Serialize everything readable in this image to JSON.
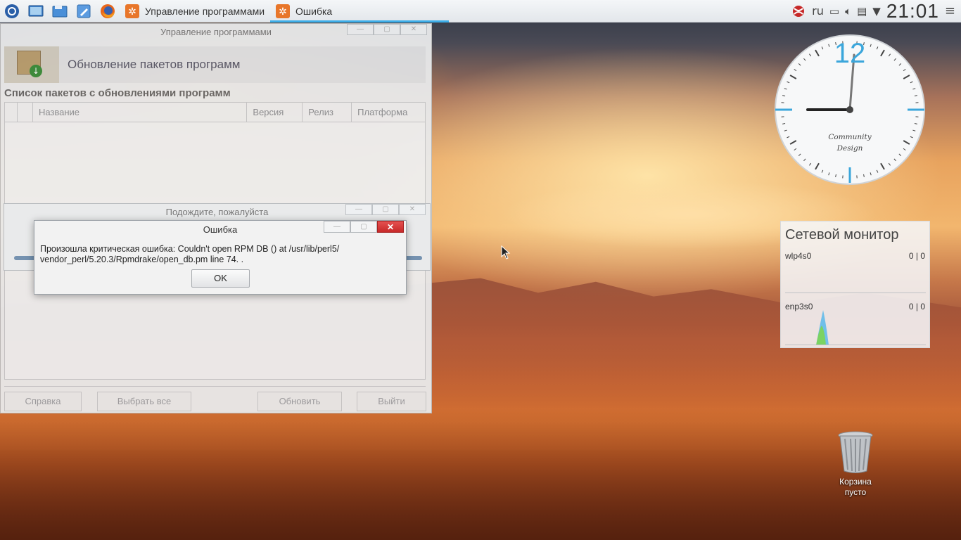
{
  "taskbar": {
    "tasks": [
      {
        "label": "Управление программами",
        "icon": "gear-icon"
      },
      {
        "label": "Ошибка",
        "icon": "gear-icon"
      }
    ],
    "tray": {
      "lang": "ru",
      "time": "21:01"
    }
  },
  "main_window": {
    "title": "Управление программами",
    "header": "Обновление пакетов программ",
    "section_title": "Список пакетов с обновлениями программ",
    "columns": [
      "Название",
      "Версия",
      "Релиз",
      "Платформа"
    ],
    "buttons": {
      "help": "Справка",
      "select_all": "Выбрать все",
      "update": "Обновить",
      "quit": "Выйти"
    }
  },
  "wait_window": {
    "title": "Подождите, пожалуйста"
  },
  "error_dialog": {
    "title": "Ошибка",
    "message_line1": "Произошла критическая ошибка: Couldn't open RPM DB () at /usr/lib/perl5/",
    "message_line2": "vendor_perl/5.20.3/Rpmdrake/open_db.pm line 74. .",
    "ok_label": "OK"
  },
  "clock_widget": {
    "twelve": "12",
    "brand_line1": "Community",
    "brand_line2": "Design",
    "hour_hand_time": "21:01"
  },
  "net_monitor": {
    "title": "Сетевой монитор",
    "interfaces": [
      {
        "name": "wlp4s0",
        "value": "0 | 0"
      },
      {
        "name": "enp3s0",
        "value": "0 | 0"
      }
    ]
  },
  "trash": {
    "label_line1": "Корзина",
    "label_line2": "пусто"
  },
  "colors": {
    "accent": "#3daee9",
    "close_red": "#d83a3a"
  }
}
